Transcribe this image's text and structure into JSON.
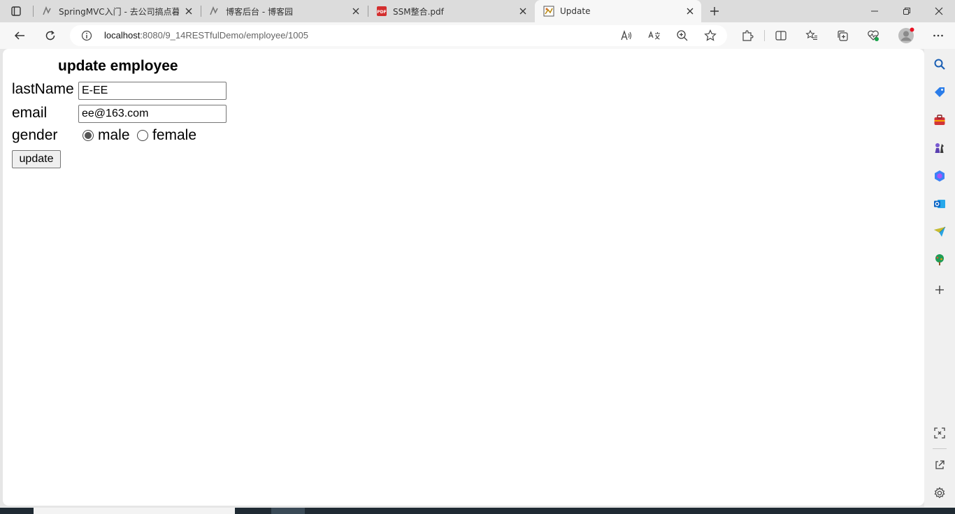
{
  "tabs": [
    {
      "title": "SpringMVC入门 - 去公司搞点暮春"
    },
    {
      "title": "博客后台 - 博客园"
    },
    {
      "title": "SSM整合.pdf",
      "badge": "PDF"
    },
    {
      "title": "Update"
    }
  ],
  "address": {
    "host": "localhost",
    "path": ":8080/9_14RESTfulDemo/employee/1005"
  },
  "form": {
    "title": "update employee",
    "lastname_label": "lastName",
    "lastname_value": "E-EE",
    "email_label": "email",
    "email_value": "ee@163.com",
    "gender_label": "gender",
    "gender_options": [
      "male",
      "female"
    ],
    "gender_selected": "male",
    "submit_label": "update"
  },
  "colors": {
    "accent": "#0078d4",
    "pdf_red": "#d32f2f",
    "profile_dot": "#e81123"
  }
}
